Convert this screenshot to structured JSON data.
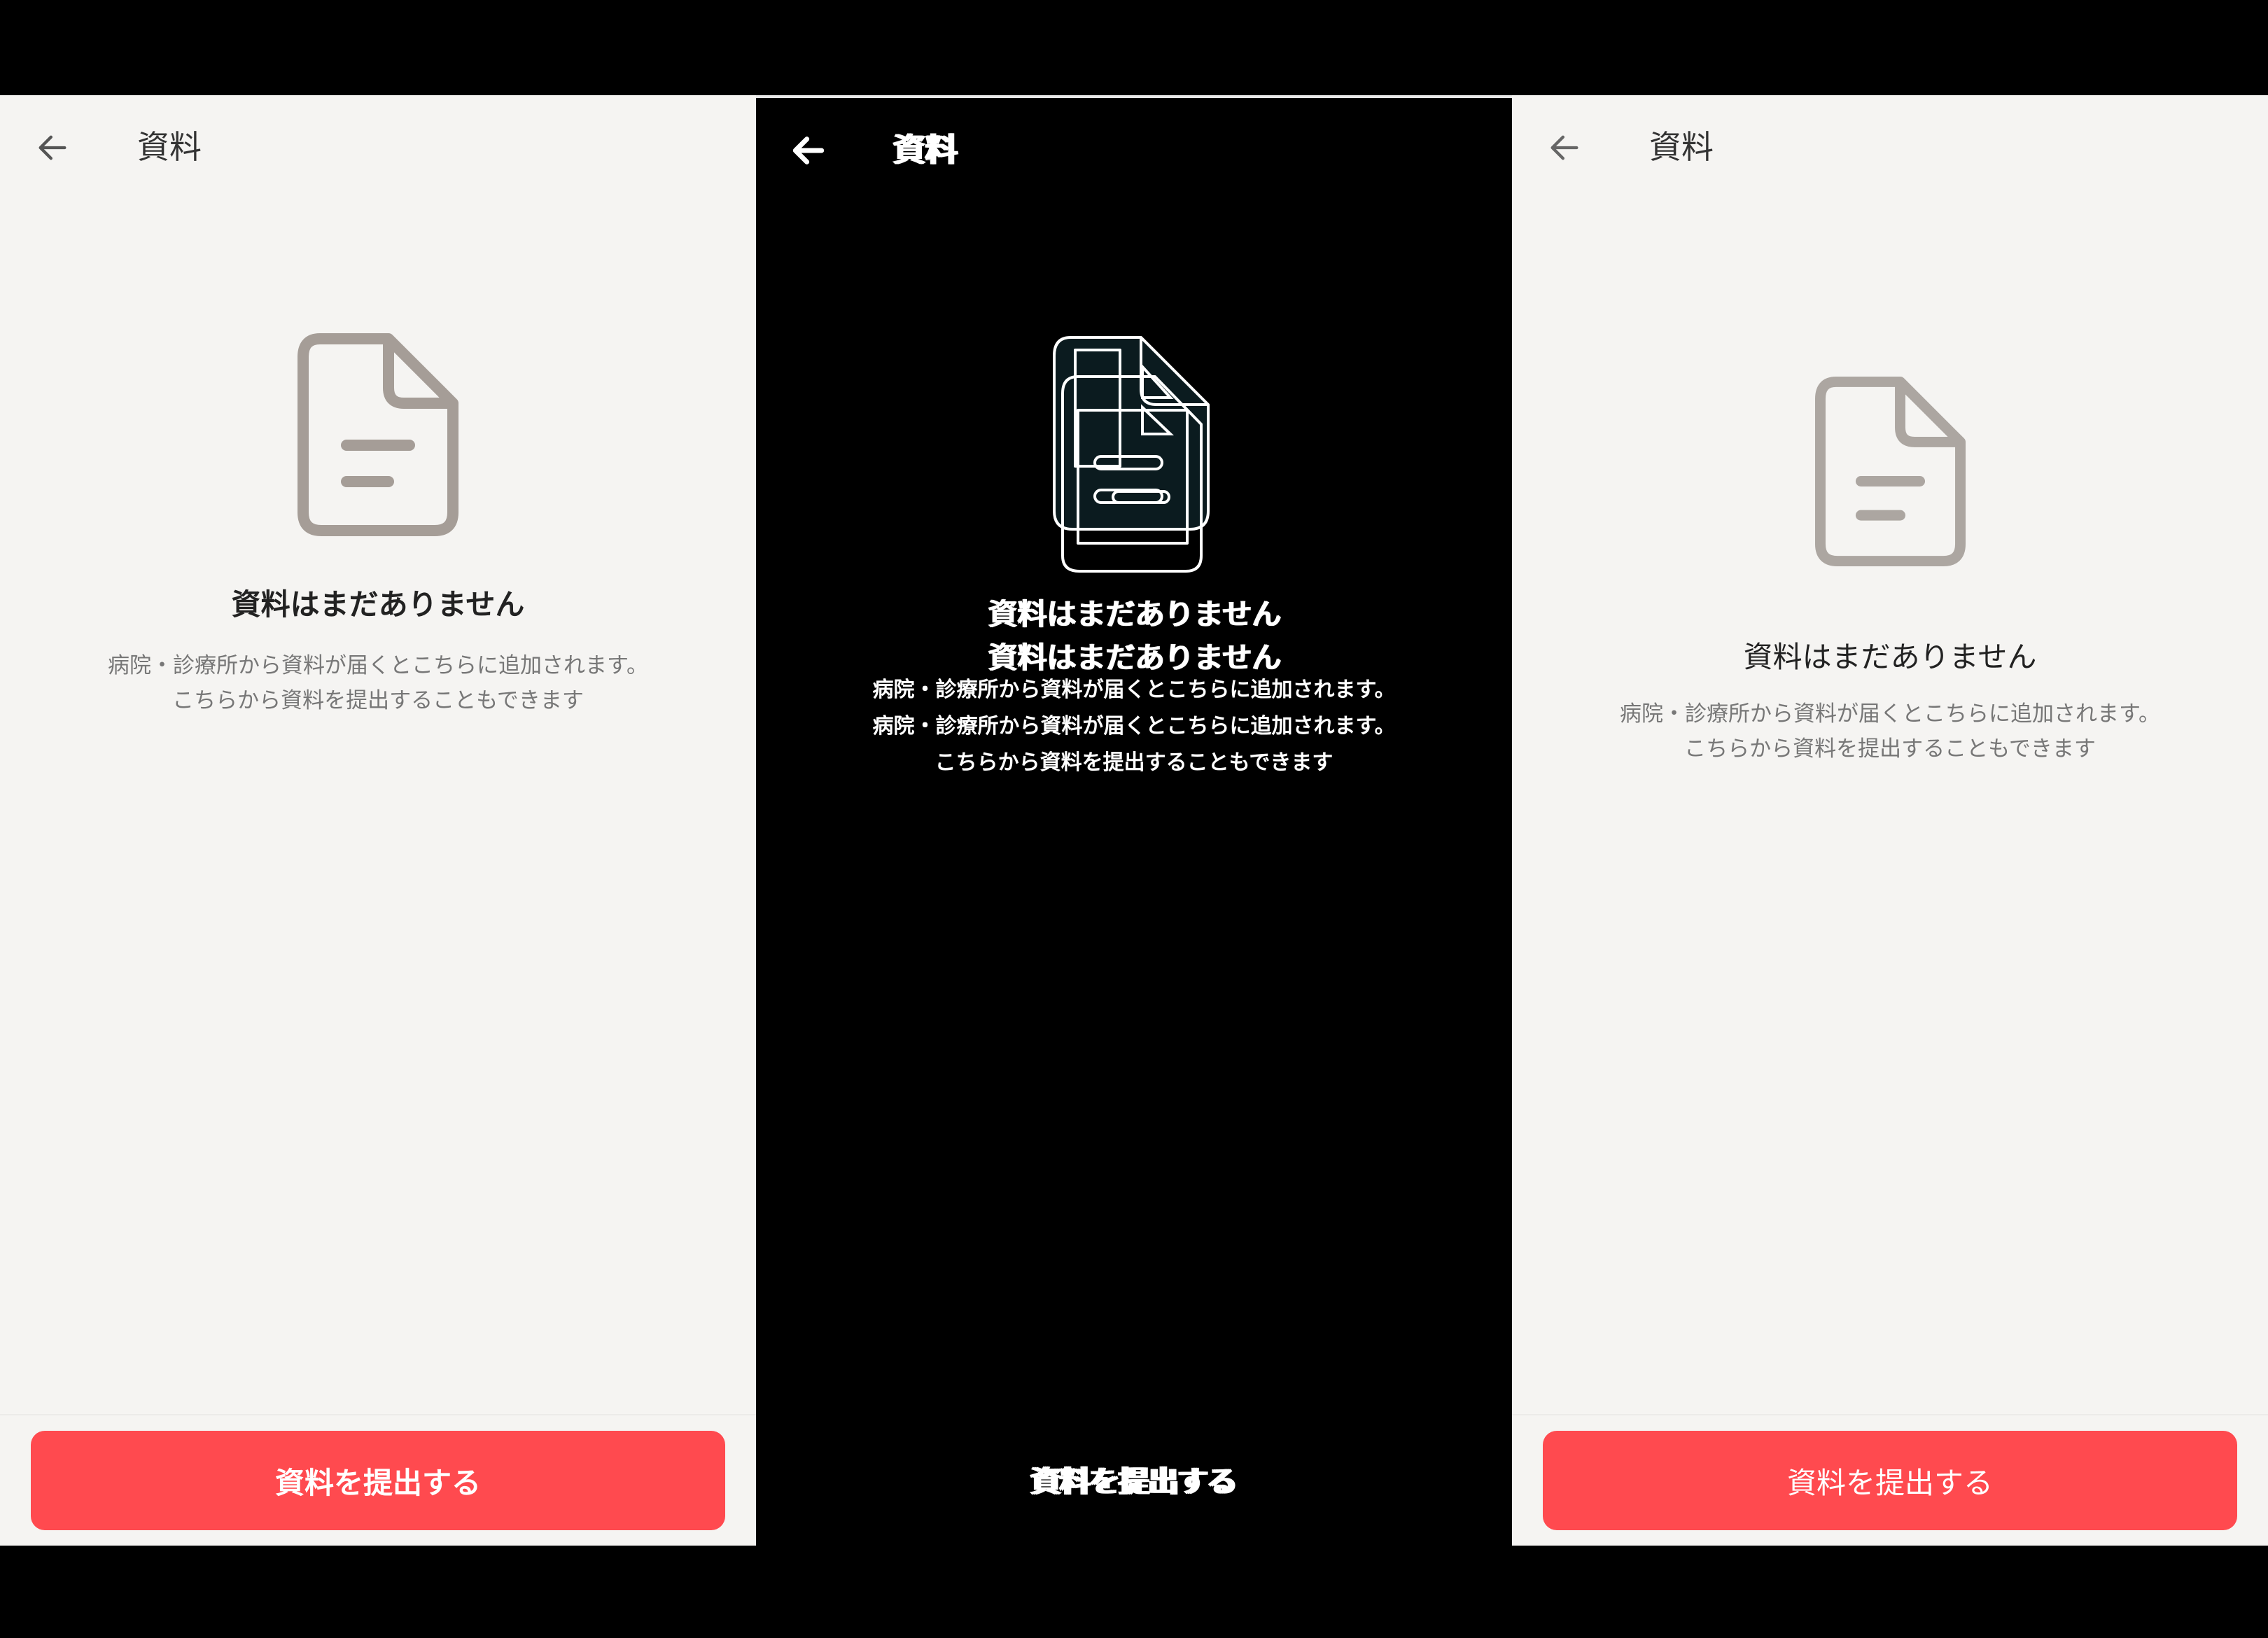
{
  "colors": {
    "background_light": "#f5f4f2",
    "background_dark": "#000000",
    "accent": "#ff4a4f",
    "icon_gray": "#a59d97",
    "text_primary": "#222222",
    "text_secondary": "#777777"
  },
  "screens": [
    {
      "theme": "light",
      "header": {
        "back_icon": "arrow-left-icon",
        "title": "資料"
      },
      "empty_state": {
        "icon": "document-icon",
        "title": "資料はまだありません",
        "description_lines": [
          "病院・診療所から資料が届くとこちらに追加されます。",
          "こちらから資料を提出することもできます"
        ]
      },
      "footer": {
        "submit_label": "資料を提出する"
      }
    },
    {
      "theme": "dark",
      "header": {
        "back_icon": "arrow-left-icon",
        "title": "資料"
      },
      "empty_state": {
        "icon": "document-icon",
        "title": "資料はまだありません",
        "description_lines": [
          "病院・診療所から資料が届くとこちらに追加されます。",
          "こちらから資料を提出することもできます"
        ]
      },
      "footer": {
        "submit_label": "資料を提出する"
      }
    },
    {
      "theme": "light",
      "header": {
        "back_icon": "arrow-left-icon",
        "title": "資料"
      },
      "empty_state": {
        "icon": "document-icon",
        "title": "資料はまだありません",
        "description_lines": [
          "病院・診療所から資料が届くとこちらに追加されます。",
          "こちらから資料を提出することもできます"
        ]
      },
      "footer": {
        "submit_label": "資料を提出する"
      }
    }
  ]
}
